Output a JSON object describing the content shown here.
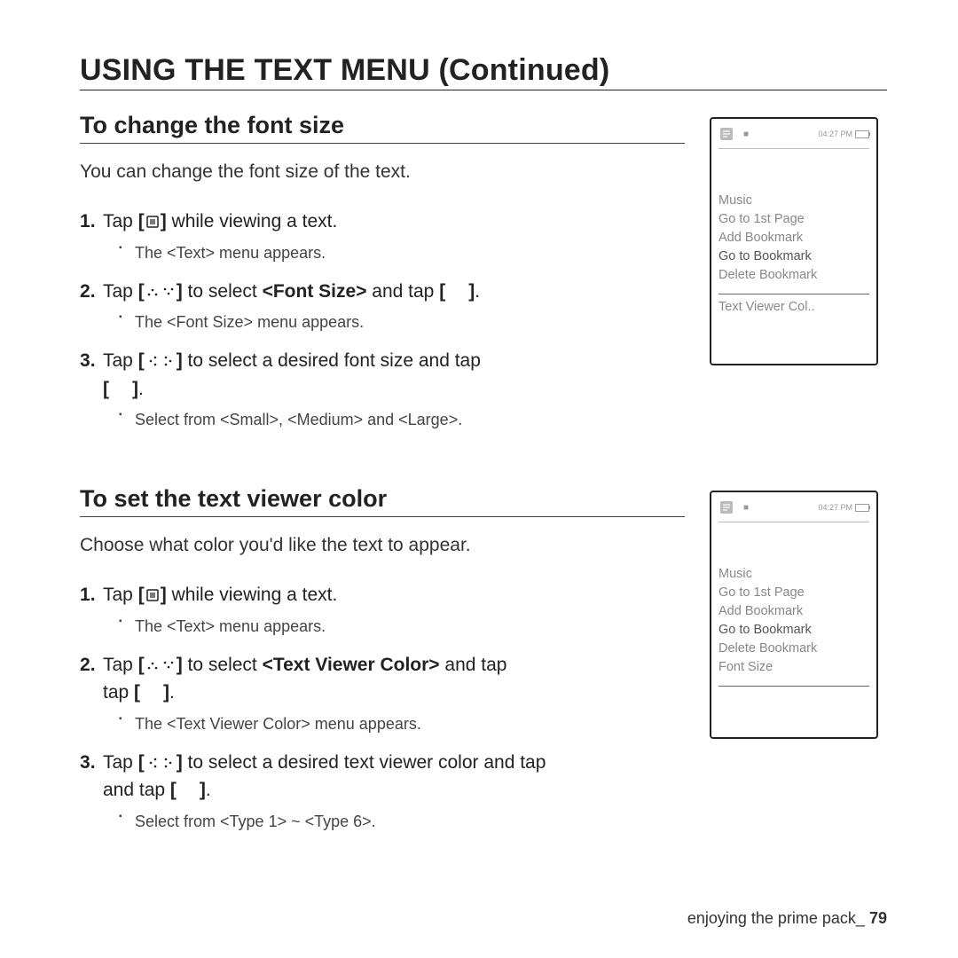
{
  "page_title": "USING THE TEXT MENU (Continued)",
  "footer": {
    "label": "enjoying the prime pack_",
    "space": " ",
    "page": "79"
  },
  "section_font": {
    "heading": "To change the font size",
    "intro": "You can change the font size of the text.",
    "step1_a": "Tap ",
    "step1_b": " while viewing a text.",
    "step1_sub": "The <Text> menu appears.",
    "step2_a": "Tap ",
    "step2_b": " to select ",
    "step2_bold": "<Font Size>",
    "step2_c": " and tap ",
    "step2_sub": "The <Font Size> menu appears.",
    "step3_a": "Tap ",
    "step3_b": " to select a desired font size and tap ",
    "step3_sub": "Select from <Small>, <Medium> and <Large>."
  },
  "section_color": {
    "heading": "To set the text viewer color",
    "intro": "Choose what color you'd like the text to appear.",
    "step1_a": "Tap ",
    "step1_b": " while viewing a text.",
    "step1_sub": "The <Text> menu appears.",
    "step2_a": "Tap ",
    "step2_b": " to select ",
    "step2_bold": "<Text Viewer Color>",
    "step2_c": " and tap ",
    "step2_sub": "The <Text Viewer Color> menu appears.",
    "step3_a": "Tap ",
    "step3_b": " to select a desired text viewer color and tap ",
    "step3_sub": "Select from <Type 1> ~ <Type 6>."
  },
  "device_menu_a": {
    "status_time": "04:27 PM",
    "items": [
      "Music",
      "Go to 1st Page",
      "Add Bookmark",
      "Go to Bookmark",
      "Delete Bookmark"
    ],
    "strong_index": 3,
    "extra": "Text Viewer Col.."
  },
  "device_menu_b": {
    "status_time": "04:27 PM",
    "items": [
      "Music",
      "Go to 1st Page",
      "Add Bookmark",
      "Go to Bookmark",
      "Delete Bookmark",
      "Font Size"
    ],
    "strong_index": 3,
    "extra": ""
  }
}
